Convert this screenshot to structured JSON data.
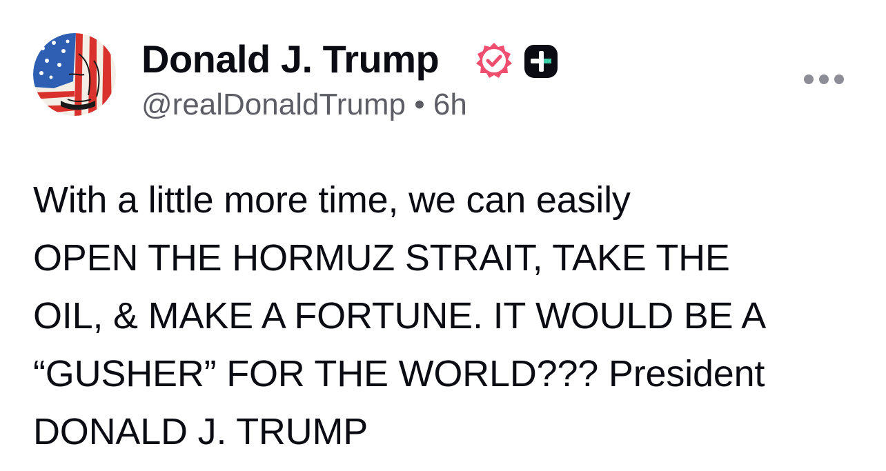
{
  "post": {
    "author_name": "Donald J. Trump",
    "author_handle": "@realDonaldTrump",
    "separator": "•",
    "timestamp": "6h",
    "body": "With a little more time, we can easily\nOPEN THE HORMUZ STRAIT, TAKE THE\nOIL, & MAKE A FORTUNE. IT WOULD BE A\n“GUSHER” FOR THE WORLD??? President\nDONALD J. TRUMP",
    "badges": [
      "verified-badge-icon",
      "plus-badge-icon"
    ],
    "more_icon": "more-options-icon"
  },
  "colors": {
    "text": "#0b0b14",
    "handle": "#5d5d66",
    "verified": "#ef4e6e",
    "plus_badge": "#0b0b14",
    "more_dots": "#8d8d97"
  }
}
